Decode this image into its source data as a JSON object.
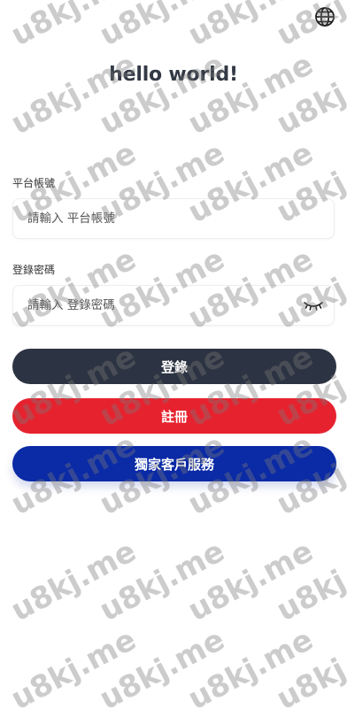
{
  "header": {
    "language_icon": "globe-icon",
    "title": "hello world!"
  },
  "form": {
    "account": {
      "label": "平台帳號",
      "placeholder": "請輸入 平台帳號",
      "value": ""
    },
    "password": {
      "label": "登錄密碼",
      "placeholder": "請輸入 登錄密碼",
      "value": "",
      "toggle_icon": "eye-closed-icon"
    }
  },
  "buttons": {
    "login": "登錄",
    "register": "註冊",
    "support": "獨家客戶服務"
  },
  "colors": {
    "login_bg": "#2c3342",
    "register_bg": "#e7222f",
    "support_bg": "#0a2aa6"
  },
  "watermark": {
    "text": "u8kj.me"
  }
}
